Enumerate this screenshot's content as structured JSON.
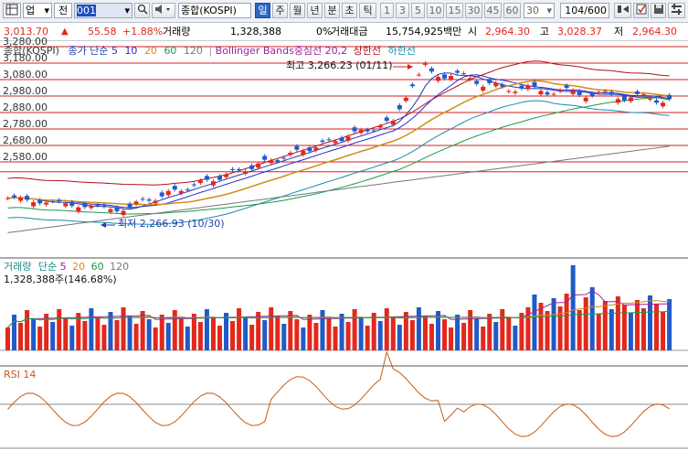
{
  "toolbar": {
    "market_select": "업",
    "prev_label": "전",
    "code_value": "001",
    "index_name": "종합(KOSPI)",
    "periods": [
      "일",
      "주",
      "월",
      "년",
      "분",
      "초",
      "틱"
    ],
    "active_period": "일",
    "intervals": [
      "1",
      "3",
      "5",
      "10",
      "15",
      "30",
      "45",
      "60"
    ],
    "interval_select": "30",
    "page_count": "104/600",
    "icons": [
      "search-icon",
      "speaker-icon",
      "dropdown-arrow-icon",
      "expand-icon",
      "checkbox-icon",
      "save-icon",
      "settings-icon"
    ]
  },
  "quote": {
    "price": "3,013.70",
    "change": "55.58",
    "change_pct": "+1.88%",
    "volume_label": "거래량",
    "volume": "1,328,388",
    "ratio": "0%",
    "amount_label": "거래대금",
    "amount": "15,754,925백만",
    "open_label": "시",
    "open": "2,964.30",
    "high_label": "고",
    "high": "3,028.37",
    "low_label": "저",
    "low": "2,964.30"
  },
  "price_panel": {
    "name": "종합(KOSPI)",
    "ma_label": "종가 단순",
    "ma_periods": [
      "5",
      "10",
      "20",
      "60",
      "120"
    ],
    "bb_label": "Bollinger Bands중심선 20,2",
    "bb_upper": "상한선",
    "bb_lower": "하한선",
    "max_label": "최고 3,266.23 (01/11)",
    "min_label": "최저 2,266.93 (10/30)",
    "y_ticks": [
      "3,280.00",
      "3,180.00",
      "3,080.00",
      "2,980.00",
      "2,880.00",
      "2,780.00",
      "2,680.00",
      "2,580.00"
    ]
  },
  "volume_panel": {
    "title": "거래량",
    "ma_label": "단순",
    "ma_periods": [
      "5",
      "20",
      "60",
      "120"
    ],
    "value": "1,328,388주(146.68%)"
  },
  "rsi_panel": {
    "title": "RSI 14"
  },
  "colors": {
    "up": "#e3281c",
    "down": "#1f5bc9",
    "ma5": "#1f3fb0",
    "ma10": "#2b2bd0",
    "ma20": "#d28c1a",
    "ma60": "#1a9a4a",
    "ma120": "#777777",
    "bb": "#b0101a",
    "bb_mid": "#d81b8a",
    "hline": "#d62020",
    "rsi_fill": "#f4b38a",
    "rsi_line": "#c85a10"
  }
}
